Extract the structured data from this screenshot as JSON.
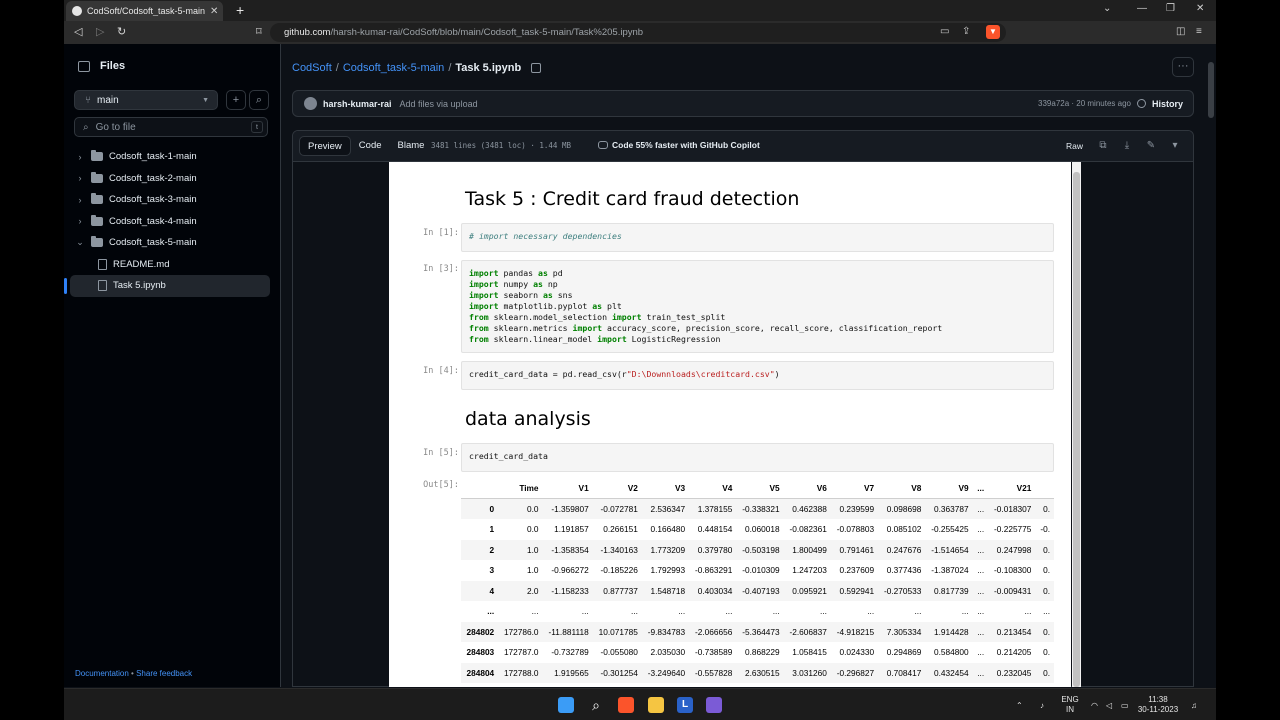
{
  "browser": {
    "tab_title": "CodSoft/Codsoft_task-5-main/T...",
    "url_host": "github.com",
    "url_path": "/harsh-kumar-rai/CodSoft/blob/main/Codsoft_task-5-main/Task%205.ipynb"
  },
  "sidebar": {
    "title": "Files",
    "branch": "main",
    "search_placeholder": "Go to file",
    "search_shortcut": "t",
    "items": [
      {
        "label": "Codsoft_task-1-main",
        "type": "folder",
        "expanded": false
      },
      {
        "label": "Codsoft_task-2-main",
        "type": "folder",
        "expanded": false
      },
      {
        "label": "Codsoft_task-3-main",
        "type": "folder",
        "expanded": false
      },
      {
        "label": "Codsoft_task-4-main",
        "type": "folder",
        "expanded": false
      },
      {
        "label": "Codsoft_task-5-main",
        "type": "folder",
        "expanded": true
      },
      {
        "label": "README.md",
        "type": "file"
      },
      {
        "label": "Task 5.ipynb",
        "type": "file",
        "selected": true
      }
    ],
    "footer_doc": "Documentation",
    "footer_sep": "•",
    "footer_feedback": "Share feedback"
  },
  "breadcrumb": {
    "repo": "CodSoft",
    "sep": "/",
    "folder": "Codsoft_task-5-main",
    "file": "Task 5.ipynb"
  },
  "commit": {
    "user": "harsh-kumar-rai",
    "message": "Add files via upload",
    "meta": "339a72a · 20 minutes ago",
    "history": "History"
  },
  "file_header": {
    "tabs": [
      "Preview",
      "Code",
      "Blame"
    ],
    "meta": "3481 lines (3481 loc) · 1.44 MB",
    "copilot": "Code 55% faster with GitHub Copilot",
    "raw": "Raw"
  },
  "notebook": {
    "title": "Task 5 : Credit card fraud detection",
    "section": "data analysis",
    "prompts": {
      "c1": "In [1]:",
      "c3": "In [3]:",
      "c4": "In [4]:",
      "c5": "In [5]:",
      "out5": "Out[5]:"
    },
    "cell1": "# import necessary dependencies",
    "cell3": [
      {
        "kw": "import",
        "rest": " pandas ",
        "kw2": "as",
        "rest2": " pd"
      },
      {
        "kw": "import",
        "rest": " numpy ",
        "kw2": "as",
        "rest2": " np"
      },
      {
        "kw": "import",
        "rest": " seaborn ",
        "kw2": "as",
        "rest2": " sns"
      },
      {
        "kw": "import",
        "rest": " matplotlib.pyplot ",
        "kw2": "as",
        "rest2": " plt"
      },
      {
        "kw": "from",
        "rest": " sklearn.model_selection ",
        "kw2": "import",
        "rest2": " train_test_split"
      },
      {
        "kw": "from",
        "rest": " sklearn.metrics ",
        "kw2": "import",
        "rest2": " accuracy_score, precision_score, recall_score, classification_report"
      },
      {
        "kw": "from",
        "rest": " sklearn.linear_model ",
        "kw2": "import",
        "rest2": " LogisticRegression"
      }
    ],
    "cell4_pre": "credit_card_data = pd.read_csv(r",
    "cell4_str": "\"D:\\Downnloads\\creditcard.csv\"",
    "cell4_post": ")",
    "cell5": "credit_card_data",
    "table": {
      "columns": [
        "",
        "Time",
        "V1",
        "V2",
        "V3",
        "V4",
        "V5",
        "V6",
        "V7",
        "V8",
        "V9",
        "...",
        "V21",
        ""
      ],
      "rows": [
        [
          "0",
          "0.0",
          "-1.359807",
          "-0.072781",
          "2.536347",
          "1.378155",
          "-0.338321",
          "0.462388",
          "0.239599",
          "0.098698",
          "0.363787",
          "...",
          "-0.018307",
          "0."
        ],
        [
          "1",
          "0.0",
          "1.191857",
          "0.266151",
          "0.166480",
          "0.448154",
          "0.060018",
          "-0.082361",
          "-0.078803",
          "0.085102",
          "-0.255425",
          "...",
          "-0.225775",
          "-0."
        ],
        [
          "2",
          "1.0",
          "-1.358354",
          "-1.340163",
          "1.773209",
          "0.379780",
          "-0.503198",
          "1.800499",
          "0.791461",
          "0.247676",
          "-1.514654",
          "...",
          "0.247998",
          "0."
        ],
        [
          "3",
          "1.0",
          "-0.966272",
          "-0.185226",
          "1.792993",
          "-0.863291",
          "-0.010309",
          "1.247203",
          "0.237609",
          "0.377436",
          "-1.387024",
          "...",
          "-0.108300",
          "0."
        ],
        [
          "4",
          "2.0",
          "-1.158233",
          "0.877737",
          "1.548718",
          "0.403034",
          "-0.407193",
          "0.095921",
          "0.592941",
          "-0.270533",
          "0.817739",
          "...",
          "-0.009431",
          "0."
        ],
        [
          "...",
          "...",
          "...",
          "...",
          "...",
          "...",
          "...",
          "...",
          "...",
          "...",
          "...",
          "...",
          "...",
          "..."
        ],
        [
          "284802",
          "172786.0",
          "-11.881118",
          "10.071785",
          "-9.834783",
          "-2.066656",
          "-5.364473",
          "-2.606837",
          "-4.918215",
          "7.305334",
          "1.914428",
          "...",
          "0.213454",
          "0."
        ],
        [
          "284803",
          "172787.0",
          "-0.732789",
          "-0.055080",
          "2.035030",
          "-0.738589",
          "0.868229",
          "1.058415",
          "0.024330",
          "0.294869",
          "0.584800",
          "...",
          "0.214205",
          "0."
        ],
        [
          "284804",
          "172788.0",
          "1.919565",
          "-0.301254",
          "-3.249640",
          "-0.557828",
          "2.630515",
          "3.031260",
          "-0.296827",
          "0.708417",
          "0.432454",
          "...",
          "0.232045",
          "0."
        ]
      ]
    }
  },
  "taskbar": {
    "lang_top": "ENG",
    "lang_bottom": "IN",
    "time": "11:38",
    "date": "30-11-2023"
  }
}
